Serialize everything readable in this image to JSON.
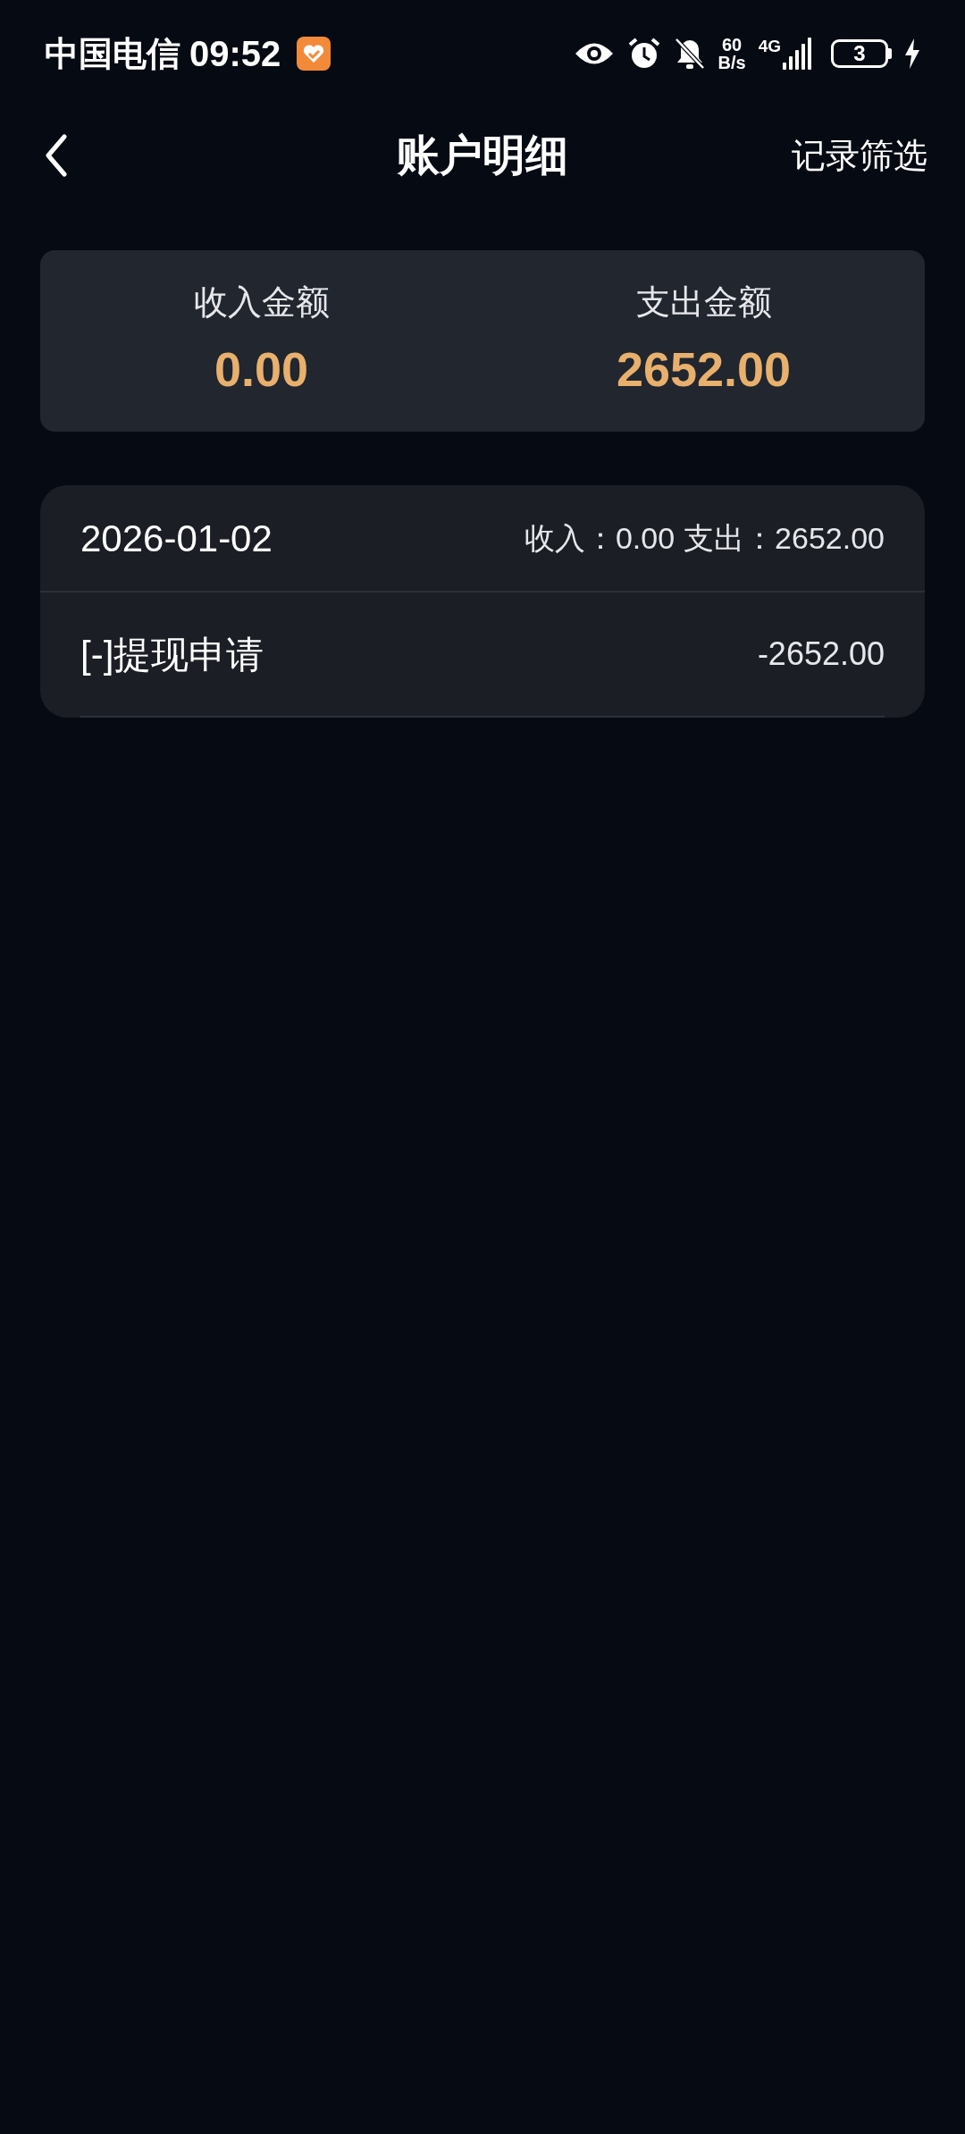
{
  "status_bar": {
    "carrier": "中国电信",
    "time": "09:52",
    "net_speed_value": "60",
    "net_speed_unit": "B/s",
    "network": "4G",
    "battery": "3"
  },
  "header": {
    "title": "账户明细",
    "action": "记录筛选"
  },
  "summary": [
    {
      "label": "收入金额",
      "amount": "0.00"
    },
    {
      "label": "支出金额",
      "amount": "2652.00"
    }
  ],
  "groups": [
    {
      "date": "2026-01-02",
      "income_label": "收入：",
      "income": "0.00",
      "expense_label": "支出：",
      "expense": "2652.00",
      "records": [
        {
          "title": "[-]提现申请",
          "amount": "-2652.00"
        }
      ]
    }
  ]
}
